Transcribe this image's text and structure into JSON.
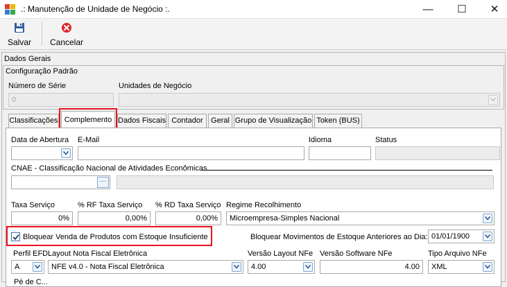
{
  "window": {
    "title": ".: Manutenção de Unidade de Negócio :.",
    "minimize_glyph": "—",
    "maximize_glyph": "☐",
    "close_glyph": "✕"
  },
  "toolbar": {
    "save_label": "Salvar",
    "cancel_label": "Cancelar"
  },
  "dados_gerais": {
    "title": "Dados Gerais",
    "config_title": "Configuração Padrão",
    "numero_serie_label": "Número de Série",
    "numero_serie_value": "0",
    "unidades_label": "Unidades de Negócio",
    "unidades_value": ""
  },
  "tabs": [
    {
      "label": "Classificações"
    },
    {
      "label": "Complemento"
    },
    {
      "label": "Dados Fiscais"
    },
    {
      "label": "Contador"
    },
    {
      "label": "Geral"
    },
    {
      "label": "Grupo de Visualização"
    },
    {
      "label": "Token (BUS)"
    }
  ],
  "complemento": {
    "data_abertura_label": "Data de Abertura",
    "data_abertura_value": "",
    "email_label": "E-Mail",
    "email_value": "",
    "idioma_label": "Idioma",
    "idioma_value": "",
    "status_label": "Status",
    "status_value": "",
    "cnae_label": "CNAE - Classificação Nacional de Atividades Econômicas",
    "cnae_value": "",
    "cnae_desc_value": "",
    "cnae_button_label": "···",
    "taxa_servico_label": "Taxa Serviço",
    "taxa_servico_value": "0%",
    "rf_taxa_label": "% RF Taxa Serviço",
    "rf_taxa_value": "0,00%",
    "rd_taxa_label": "% RD Taxa Serviço",
    "rd_taxa_value": "0,00%",
    "regime_label": "Regime Recolhimento",
    "regime_value": "Microempresa-Simples Nacional",
    "bloquear_venda_label": "Bloquear Venda de Produtos com Estoque Insuficiente",
    "bloquear_venda_checked": true,
    "bloquear_mov_label": "Bloquear Movimentos de Estoque Anteriores ao Dia:",
    "bloquear_mov_value": "01/01/1900",
    "perfil_efd_label": "Perfil EFD",
    "perfil_efd_value": "A",
    "layout_nf_label": "Layout Nota Fiscal Eletrônica",
    "layout_nf_value": "NFE v4.0 - Nota Fiscal Eletrônica",
    "versao_layout_label": "Versão Layout NFe",
    "versao_layout_value": "4.00",
    "versao_software_label": "Versão Software NFe",
    "versao_software_value": "4.00",
    "tipo_arquivo_label": "Tipo Arquivo NFe",
    "tipo_arquivo_value": "XML",
    "cut_label": "Pé de C..."
  },
  "colors": {
    "highlight_red": "#e8141c",
    "save_icon_blue": "#2f5d9e",
    "cancel_icon_red": "#d9262c"
  }
}
